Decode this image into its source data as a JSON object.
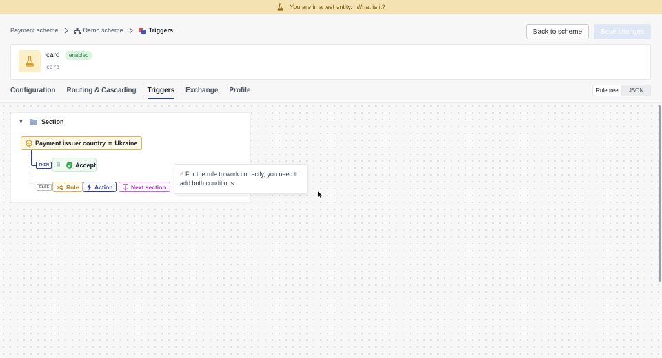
{
  "banner": {
    "text": "You are in a test entity.",
    "link": "What is it?",
    "icon": "flask-icon"
  },
  "breadcrumb": {
    "items": [
      "Payment scheme",
      "Demo scheme",
      "Triggers"
    ]
  },
  "header": {
    "back_label": "Back to scheme",
    "save_label": "Save changes"
  },
  "entity": {
    "name": "card",
    "status": "enabled",
    "subtitle": "card"
  },
  "tabs": [
    {
      "label": "Configuration"
    },
    {
      "label": "Routing & Cascading"
    },
    {
      "label": "Triggers",
      "active": true
    },
    {
      "label": "Exchange"
    },
    {
      "label": "Profile"
    }
  ],
  "view_toggle": {
    "options": [
      "Rule tree",
      "JSON"
    ],
    "selected": "Rule tree"
  },
  "section": {
    "title": "Section",
    "condition": {
      "field": "Payment issuer country",
      "operator": "=",
      "value": "Ukraine"
    },
    "then_tag": "THEN",
    "else_tag": "ELSE",
    "then_action": "Accept",
    "else_buttons": {
      "rule": "Rule",
      "action": "Action",
      "next": "Next section"
    }
  },
  "tooltip": {
    "emoji": "☝",
    "text": "For the rule to work correctly, you need to add both conditions"
  },
  "colors": {
    "banner_bg": "#f4e2b3",
    "accent": "#2f3e9c",
    "condition_border": "#e2b44a",
    "accept_bg": "#effaf2",
    "next_color": "#a93cc4",
    "badge_bg": "#ddf3e2"
  }
}
